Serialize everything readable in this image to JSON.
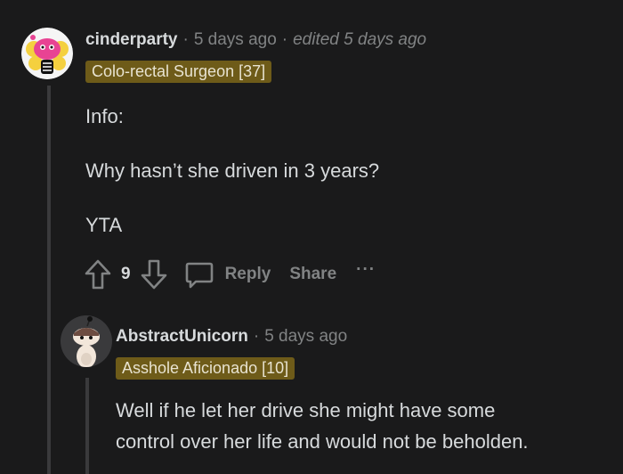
{
  "comment": {
    "username": "cinderparty",
    "separator": "·",
    "age": "5 days ago",
    "edited": "edited 5 days ago",
    "flair": "Colo-rectal Surgeon [37]",
    "paragraphs": [
      "Info:",
      "Why hasn’t she driven in 3 years?",
      "YTA"
    ],
    "votes": "9",
    "reply_label": "Reply",
    "share_label": "Share",
    "more_label": "···"
  },
  "reply": {
    "username": "AbstractUnicorn",
    "separator": "·",
    "age": "5 days ago",
    "flair": "Asshole Aficionado [10]",
    "line1": "Well if he let her drive she might have some",
    "line2": "control over her life and would not be beholden."
  },
  "colors": {
    "background": "#1a1a1b",
    "flair_bg": "#6e5b19",
    "muted": "#818384",
    "text": "#d7dadc"
  }
}
